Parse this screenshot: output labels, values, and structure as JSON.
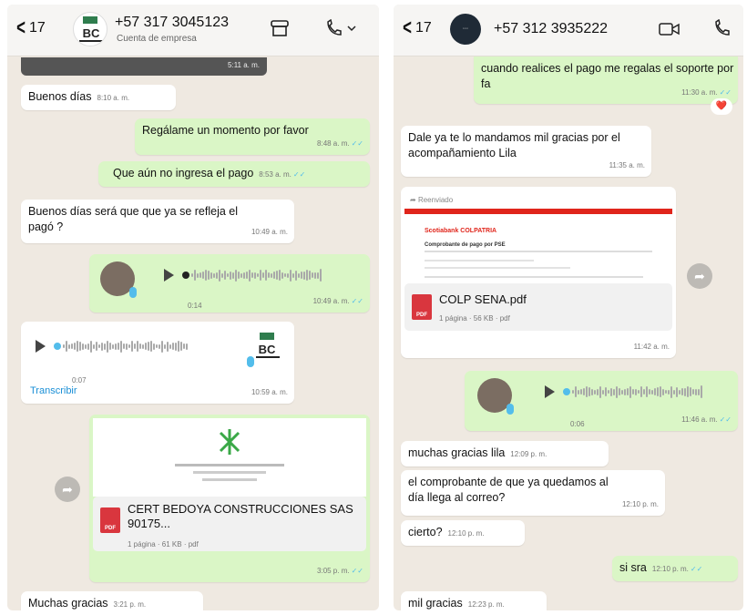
{
  "left": {
    "back_count": "17",
    "contact_name": "+57 317 3045123",
    "contact_sub": "Cuenta de empresa",
    "top_time": "5:11 a. m.",
    "messages": {
      "m1": {
        "text": "Buenos días",
        "time": "8:10 a. m."
      },
      "m2": {
        "text": "Regálame un momento por favor",
        "time": "8:48 a. m."
      },
      "m3": {
        "text": "Que aún no ingresa el pago",
        "time": "8:53 a. m."
      },
      "m4": {
        "text": "Buenos días será que que ya se refleja el pagó ?",
        "time": "10:49 a. m."
      },
      "m5": {
        "duration": "0:14",
        "time": "10:49 a. m."
      },
      "m6": {
        "duration": "0:07",
        "time": "10:59 a. m.",
        "transcribe": "Transcribir"
      },
      "m7": {
        "file_name": "CERT BEDOYA CONSTRUCCIONES SAS 90175...",
        "file_meta": "1 página · 61 KB · pdf",
        "time": "3:05 p. m.",
        "preview_org": "SENA"
      },
      "m8": {
        "text": "Muchas gracias",
        "time": "3:21 p. m."
      }
    }
  },
  "right": {
    "back_count": "17",
    "contact_name": "+57 312 3935222",
    "messages": {
      "r1": {
        "text": "cuando realices el pago me regalas el soporte por fa",
        "time": "11:30 a. m.",
        "reaction": "❤️"
      },
      "r2": {
        "text": "Dale ya te lo mandamos mil gracias por el acompañamiento Lila",
        "time": "11:35 a. m."
      },
      "r3": {
        "forwarded": "Reenviado",
        "preview_bank": "Scotiabank COLPATRIA",
        "preview_title": "Comprobante de pago por PSE",
        "file_name": "COLP SENA.pdf",
        "file_meta": "1 página · 56 KB · pdf",
        "time": "11:42 a. m."
      },
      "r4": {
        "duration": "0:06",
        "time": "11:46 a. m."
      },
      "r5": {
        "text": "muchas gracias lila",
        "time": "12:09 p. m."
      },
      "r6": {
        "text": "el comprobante de que ya quedamos al día llega al correo?",
        "time": "12:10 p. m."
      },
      "r7": {
        "text": "cierto?",
        "time": "12:10 p. m."
      },
      "r8": {
        "text": "si sra",
        "time": "12:10 p. m."
      },
      "r9": {
        "text": "mil gracias",
        "time": "12:23 p. m."
      }
    }
  },
  "colors": {
    "incoming": "#ffffff",
    "outgoing": "#daf6c6",
    "read_tick": "#53bdeb",
    "wallpaper": "#efe9e1"
  }
}
